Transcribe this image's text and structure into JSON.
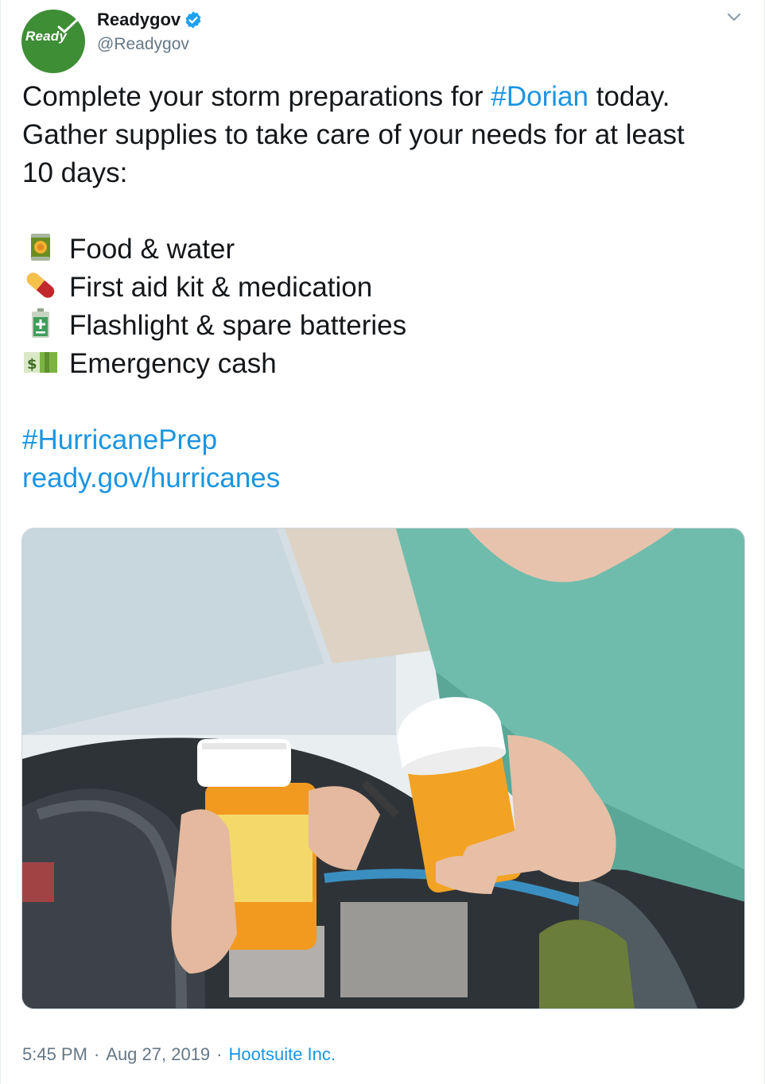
{
  "author": {
    "display_name": "Readygov",
    "handle": "@Readygov",
    "verified": true,
    "avatar_text": "Ready",
    "avatar_color": "#3e8e36"
  },
  "tweet": {
    "line1_pre": "Complete your storm preparations for ",
    "line1_hashtag": "#Dorian",
    "line1_post": " today.",
    "line2": "Gather supplies to take care of your needs for at least",
    "line3": "10 days:",
    "items": [
      {
        "icon": "canned-food-icon",
        "label": "Food & water"
      },
      {
        "icon": "pill-icon",
        "label": "First aid kit & medication"
      },
      {
        "icon": "battery-icon",
        "label": "Flashlight & spare batteries"
      },
      {
        "icon": "dollar-banknote-icon",
        "label": "Emergency cash"
      }
    ],
    "hashtag": "#HurricanePrep",
    "link": "ready.gov/hurricanes"
  },
  "footer": {
    "time": "5:45 PM",
    "separator": "·",
    "date": "Aug 27, 2019",
    "source": "Hootsuite Inc."
  },
  "colors": {
    "link": "#1b95e0",
    "secondary_text": "#657786",
    "primary_text": "#14171a"
  }
}
